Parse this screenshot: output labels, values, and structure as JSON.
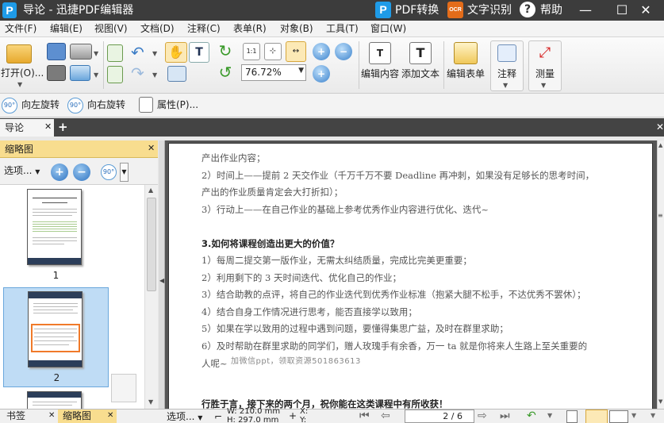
{
  "titlebar": {
    "title": "导论 - 迅捷PDF编辑器",
    "pdf_convert": "PDF转换",
    "ocr": "文字识别",
    "ocr_badge": "OCR",
    "help": "帮助",
    "minimize": "—",
    "maximize": "☐",
    "close": "✕"
  },
  "menu": [
    "文件(F)",
    "编辑(E)",
    "视图(V)",
    "文档(D)",
    "注释(C)",
    "表单(R)",
    "对象(B)",
    "工具(T)",
    "窗口(W)"
  ],
  "ribbon": {
    "open": "打开(O)...",
    "zoom": "76.72%",
    "edit_content": "编辑内容",
    "add_text": "添加文本",
    "edit_form": "编辑表单",
    "annotate": "注释",
    "measure": "测量"
  },
  "toolbar2": {
    "rotate_left": "向左旋转",
    "rotate_right": "向右旋转",
    "properties": "属性(P)...",
    "rot_badge": "90°"
  },
  "tabs": {
    "doc": "导论",
    "close": "✕",
    "new": "+"
  },
  "panel": {
    "title": "缩略图",
    "close": "✕",
    "options": "选项...",
    "zoom_in": "+",
    "zoom_out": "−",
    "rot_badge": "90°",
    "thumbnails": [
      {
        "page": "1",
        "selected": false
      },
      {
        "page": "2",
        "selected": true
      }
    ]
  },
  "document": {
    "lines": [
      "产出作业内容；",
      "2）时间上——提前 2 天交作业（千万千万不要 Deadline 再冲刺，如果没有足够长的思考时间，",
      "产出的作业质量肯定会大打折扣）；",
      "3）行动上——在自己作业的基础上参考优秀作业内容进行优化、迭代~",
      "3.如何将课程创造出更大的价值？",
      "1）每周二提交第一版作业，无需太纠结质量，完成比完美更重要；",
      "2）利用剩下的 3 天时间迭代、优化自己的作业；",
      "3）结合助教的点评，将自己的作业迭代到优秀作业标准（抱紧大腿不松手，不达优秀不罢休）；",
      "4）结合自身工作情况进行思考，能否直接学以致用；",
      "5）如果在学以致用的过程中遇到问题，要懂得集思广益，及时在群里求助；",
      "6）及时帮助在群里求助的同学们，赠人玫瑰手有余香，万一 ta 就是你将来人生路上至关重要的",
      "人呢~",
      "行胜于言，接下来的两个月，祝你能在这类课程中有所收获！"
    ],
    "watermark": "加微信ppt，领取资源501863613"
  },
  "bottom": {
    "bookmarks_tab": "书签",
    "thumbs_tab": "缩略图",
    "tab_close": "✕",
    "options": "选项...",
    "width": "W: 210.0 mm",
    "height": "H: 297.0 mm",
    "x": "X:",
    "y": "Y:",
    "page": "2 / 6"
  }
}
